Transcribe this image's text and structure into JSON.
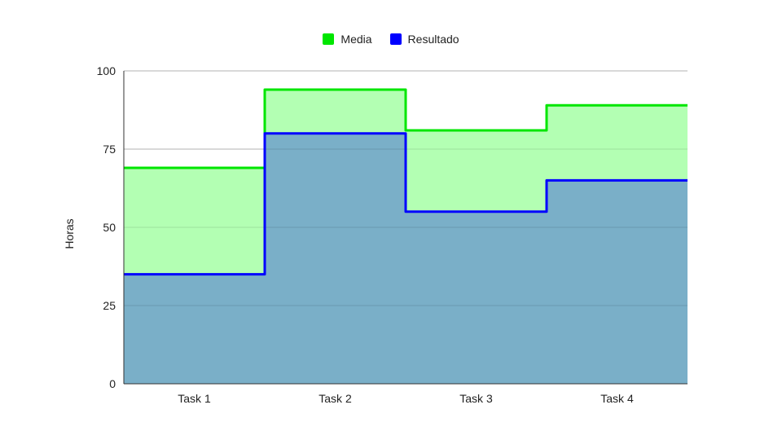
{
  "chart_data": {
    "type": "area",
    "subtype": "stepped",
    "categories": [
      "Task 1",
      "Task 2",
      "Task 3",
      "Task 4"
    ],
    "series": [
      {
        "name": "Media",
        "values": [
          69,
          94,
          81,
          89
        ],
        "color": "#00e600",
        "fill": "#b3ffb3"
      },
      {
        "name": "Resultado",
        "values": [
          35,
          80,
          55,
          65
        ],
        "color": "#0000ff",
        "fill": "#7aafc8"
      }
    ],
    "xlabel": "",
    "ylabel": "Horas",
    "ylim": [
      0,
      100
    ],
    "yticks": [
      0,
      25,
      50,
      75,
      100
    ],
    "grid": true,
    "legend_position": "top"
  }
}
